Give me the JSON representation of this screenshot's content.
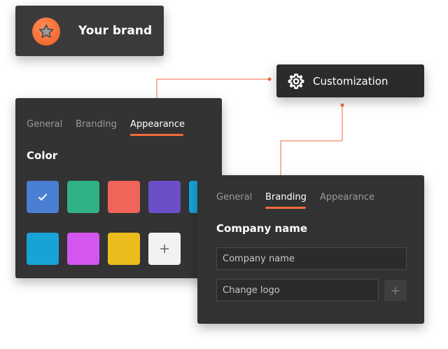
{
  "brand": {
    "name": "Your brand",
    "logo_icon": "star-icon"
  },
  "customization": {
    "label": "Customization",
    "icon": "gear-icon"
  },
  "appearance_panel": {
    "tabs": [
      {
        "label": "General",
        "active": false
      },
      {
        "label": "Branding",
        "active": false
      },
      {
        "label": "Appearance",
        "active": true
      }
    ],
    "section_title": "Color",
    "swatches": [
      {
        "color": "#4a7fd4",
        "selected": true
      },
      {
        "color": "#2fb385",
        "selected": false
      },
      {
        "color": "#f0645a",
        "selected": false
      },
      {
        "color": "#6b4fc9",
        "selected": false
      },
      {
        "color": "#17a3d6",
        "selected": false
      },
      {
        "color": "#17a3d6",
        "selected": false
      },
      {
        "color": "#d356ee",
        "selected": false
      },
      {
        "color": "#ebbd1c",
        "selected": false
      }
    ],
    "add_swatch_icon": "plus-icon"
  },
  "branding_panel": {
    "tabs": [
      {
        "label": "General",
        "active": false
      },
      {
        "label": "Branding",
        "active": true
      },
      {
        "label": "Appearance",
        "active": false
      }
    ],
    "section_title": "Company name",
    "company_name_placeholder": "Company name",
    "logo_placeholder": "Change logo",
    "add_logo_icon": "plus-icon"
  },
  "colors": {
    "accent": "#f26b3a",
    "card_bg": "#333333"
  }
}
